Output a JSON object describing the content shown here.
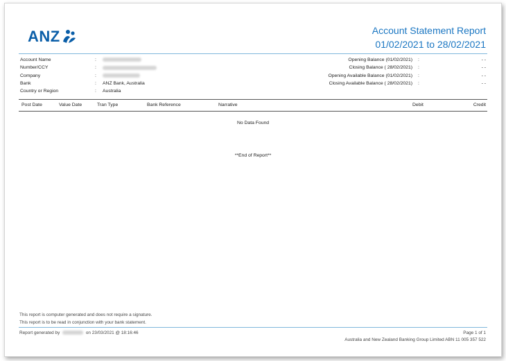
{
  "header": {
    "logo_text": "ANZ",
    "title": "Account Statement Report",
    "period": "01/02/2021 to 28/02/2021"
  },
  "account_info": [
    {
      "label": "Account Name",
      "sep": ":",
      "value": ""
    },
    {
      "label": "Number/CCY",
      "sep": ":",
      "value": ""
    },
    {
      "label": "Company",
      "sep": ":",
      "value": ""
    },
    {
      "label": "Bank",
      "sep": ":",
      "value": "ANZ Bank, Australia"
    },
    {
      "label": "Country or Region",
      "sep": ":",
      "value": "Australia"
    }
  ],
  "balances": [
    {
      "label": "Opening Balance (01/02/2021)",
      "sep": ":",
      "value": "- -"
    },
    {
      "label": "Closing Balance ( 28/02/2021)",
      "sep": ":",
      "value": "- -"
    },
    {
      "label": "Opening Available Balance  (01/02/2021)",
      "sep": ":",
      "value": "- -"
    },
    {
      "label": "Closing Available Balance  ( 28/02/2021)",
      "sep": ":",
      "value": "- -"
    }
  ],
  "table": {
    "columns": [
      "Post Date",
      "Value Date",
      "Tran Type",
      "Bank Reference",
      "Narrative",
      "Debit",
      "Credit"
    ],
    "empty_message": "No Data Found",
    "end_message": "**End of Report**"
  },
  "footer": {
    "note1": "This report is computer generated and does not require a signature.",
    "note2": "This report is to be read in conjunction with your bank statement.",
    "generated_prefix": "Report generated by",
    "generated_suffix": "on 23/03/2021 @ 18:16:46",
    "page": "Page  1  of 1",
    "company": "Australia and New Zealand Banking Group Limited ABN 11 005 357 522"
  },
  "colors": {
    "brand_blue": "#0a5ea8",
    "title_blue": "#1a76c2",
    "rule_blue": "#7eb6dc"
  }
}
